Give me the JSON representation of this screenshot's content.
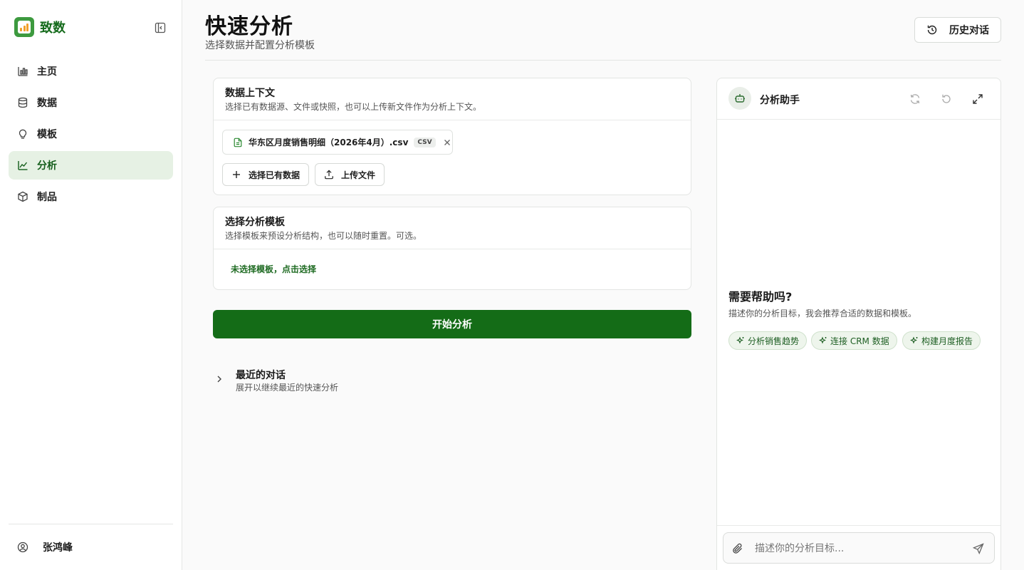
{
  "brand": {
    "name": "致数"
  },
  "sidebar": {
    "items": [
      {
        "label": "主页",
        "icon": "bar-chart-icon"
      },
      {
        "label": "数据",
        "icon": "database-icon"
      },
      {
        "label": "模板",
        "icon": "lightbulb-icon"
      },
      {
        "label": "分析",
        "icon": "line-chart-icon",
        "active": true
      },
      {
        "label": "制品",
        "icon": "box-icon"
      }
    ],
    "user": {
      "name": "张鸿峰"
    }
  },
  "header": {
    "title": "快速分析",
    "subtitle": "选择数据并配置分析模板",
    "history_label": "历史对话"
  },
  "data_context": {
    "title": "数据上下文",
    "description": "选择已有数据源、文件或快照，也可以上传新文件作为分析上下文。",
    "file": {
      "name": "华东区月度销售明细（2026年4月）.csv",
      "tag": "CSV"
    },
    "select_existing_label": "选择已有数据",
    "upload_label": "上传文件"
  },
  "template": {
    "title": "选择分析模板",
    "description": "选择模板来预设分析结构，也可以随时重置。可选。",
    "empty_label": "未选择模板，点击选择"
  },
  "start_label": "开始分析",
  "recent": {
    "title": "最近的对话",
    "description": "展开以继续最近的快速分析"
  },
  "assistant": {
    "title": "分析助手",
    "help_title": "需要帮助吗?",
    "help_desc": "描述你的分析目标，我会推荐合适的数据和模板。",
    "suggestions": [
      "分析销售趋势",
      "连接 CRM 数据",
      "构建月度报告"
    ],
    "input_placeholder": "描述你的分析目标..."
  },
  "colors": {
    "brand_green": "#146c17",
    "active_nav_bg": "#e6f1e4",
    "suggest_bg": "#eef5ec"
  }
}
